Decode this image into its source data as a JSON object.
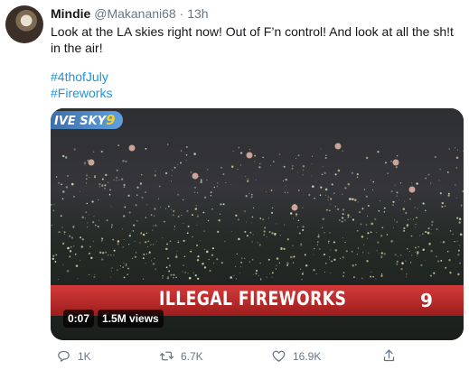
{
  "tweet": {
    "name": "Mindie",
    "handle": "@Makanani68",
    "separator": "·",
    "time": "13h",
    "text": "Look at the LA skies right now! Out of F’n control! And look at all the sh!t in the air!",
    "hashtags": [
      "#4thofJuly",
      "#Fireworks"
    ]
  },
  "media": {
    "logo_text": "IVE SKY",
    "logo_number": "9",
    "banner_text": "ILLEGAL FIREWORKS",
    "channel_logo": "9",
    "duration": "0:07",
    "views": "1.5M views"
  },
  "actions": {
    "reply_count": "1K",
    "retweet_count": "6.7K",
    "like_count": "16.9K"
  },
  "colors": {
    "hashtag": "#1b95e0",
    "meta_gray": "#657786",
    "banner_red": "#c62b2b"
  },
  "icons": [
    "reply-icon",
    "retweet-icon",
    "like-icon",
    "share-icon"
  ]
}
